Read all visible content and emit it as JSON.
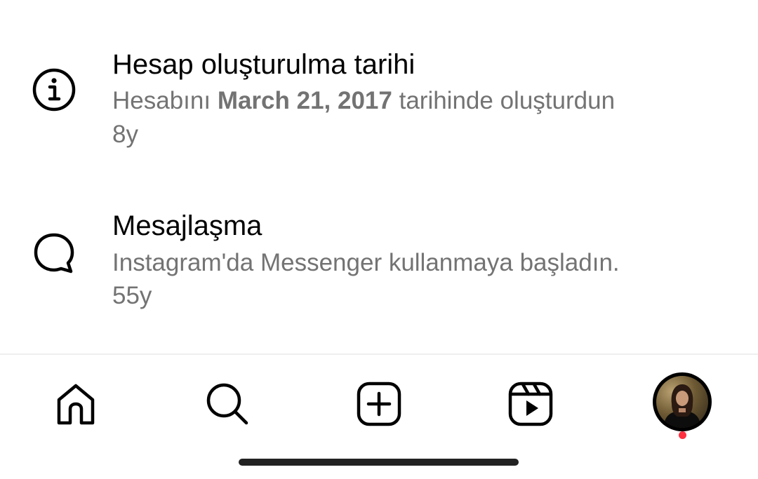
{
  "activity": [
    {
      "icon": "info-icon",
      "title": "Hesap oluşturulma tarihi",
      "subtitle_prefix": "Hesabını ",
      "subtitle_bold": "March 21, 2017",
      "subtitle_suffix": " tarihinde oluşturdun",
      "time": "8y"
    },
    {
      "icon": "message-bubble-icon",
      "title": "Mesajlaşma",
      "subtitle": "Instagram'da Messenger kullanmaya başladın.",
      "time": "55y"
    }
  ],
  "bottom_nav": {
    "items": [
      "home-icon",
      "search-icon",
      "create-post-icon",
      "reels-icon",
      "profile-avatar"
    ],
    "notification_dot_color": "#ff3040"
  },
  "colors": {
    "primary_text": "#000000",
    "secondary_text": "#737373",
    "divider": "#efefef"
  }
}
